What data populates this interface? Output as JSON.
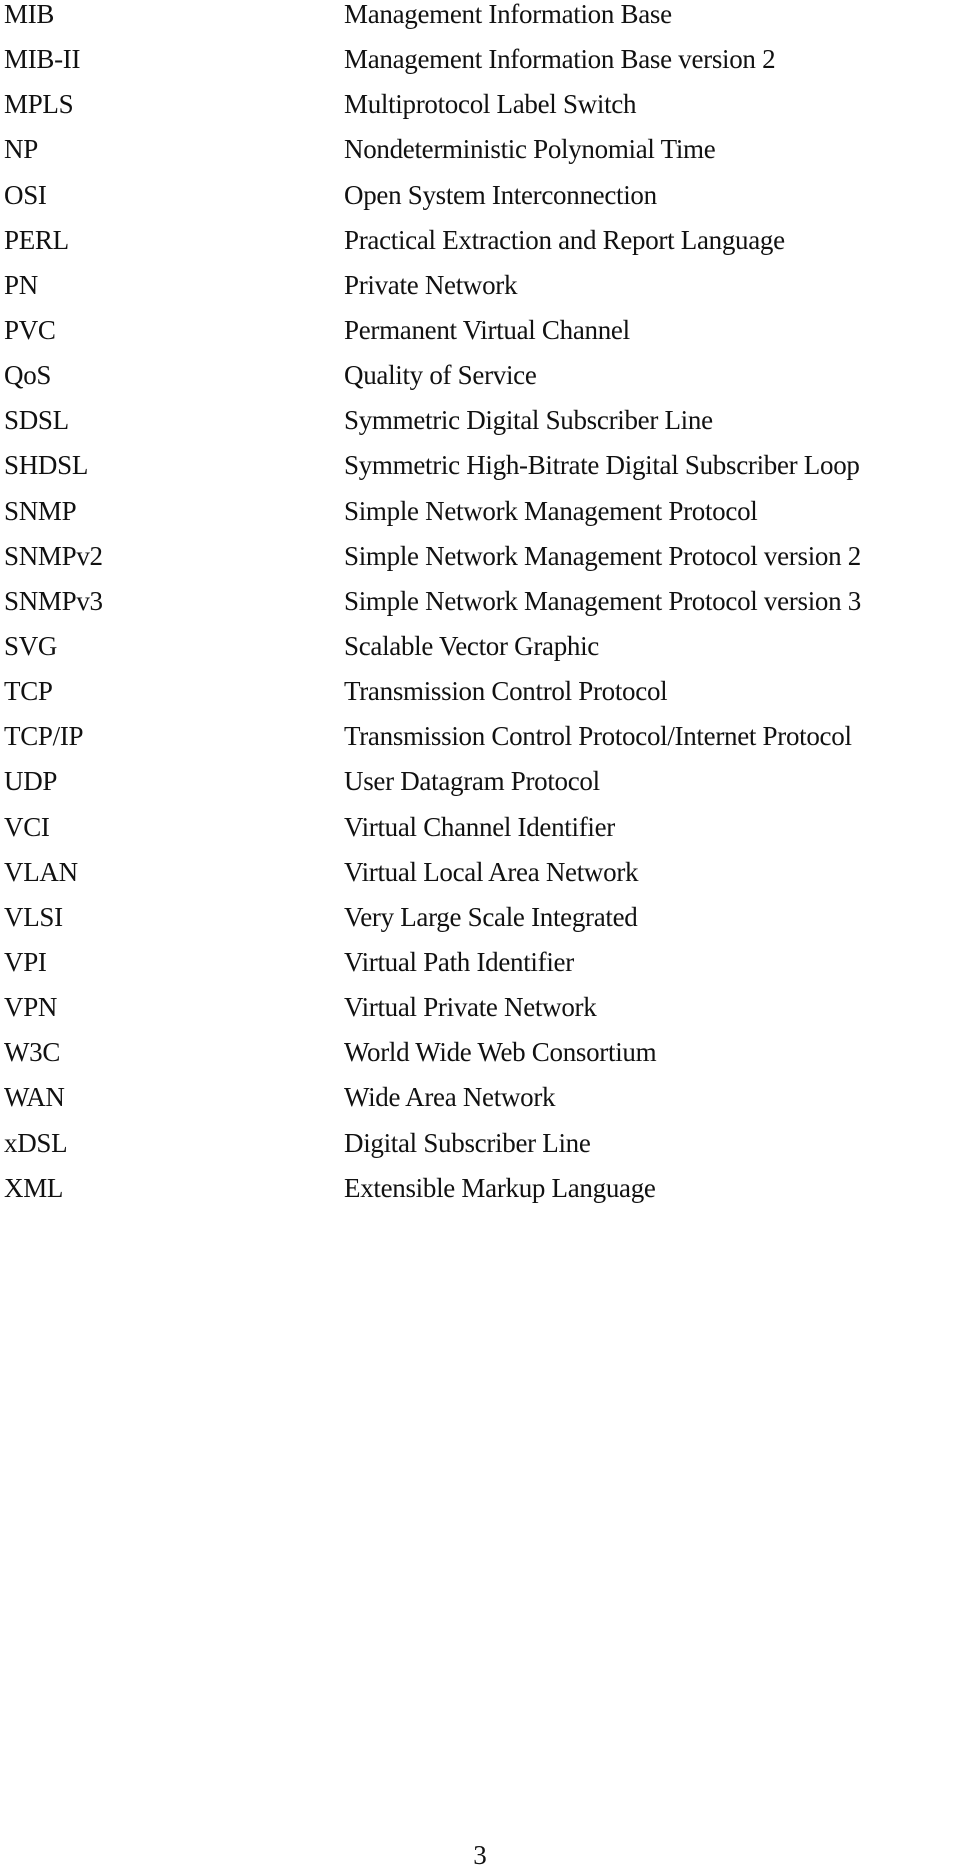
{
  "abbreviations": [
    {
      "term": "MIB",
      "definition": "Management Information Base"
    },
    {
      "term": "MIB-II",
      "definition": "Management Information Base version 2"
    },
    {
      "term": "MPLS",
      "definition": "Multiprotocol Label Switch"
    },
    {
      "term": "NP",
      "definition": "Nondeterministic Polynomial Time"
    },
    {
      "term": "OSI",
      "definition": "Open System Interconnection"
    },
    {
      "term": "PERL",
      "definition": "Practical Extraction and Report Language"
    },
    {
      "term": "PN",
      "definition": "Private Network"
    },
    {
      "term": "PVC",
      "definition": "Permanent Virtual Channel"
    },
    {
      "term": "QoS",
      "definition": "Quality of Service"
    },
    {
      "term": "SDSL",
      "definition": "Symmetric Digital Subscriber Line"
    },
    {
      "term": "SHDSL",
      "definition": "Symmetric High-Bitrate Digital Subscriber Loop"
    },
    {
      "term": "SNMP",
      "definition": "Simple Network Management Protocol"
    },
    {
      "term": "SNMPv2",
      "definition": "Simple Network Management Protocol version 2"
    },
    {
      "term": "SNMPv3",
      "definition": "Simple Network Management Protocol version 3"
    },
    {
      "term": "SVG",
      "definition": "Scalable Vector Graphic"
    },
    {
      "term": "TCP",
      "definition": "Transmission Control Protocol"
    },
    {
      "term": "TCP/IP",
      "definition": "Transmission Control Protocol/Internet Protocol"
    },
    {
      "term": "UDP",
      "definition": "User Datagram Protocol"
    },
    {
      "term": "VCI",
      "definition": "Virtual Channel Identifier"
    },
    {
      "term": "VLAN",
      "definition": "Virtual Local Area Network"
    },
    {
      "term": "VLSI",
      "definition": "Very Large Scale Integrated"
    },
    {
      "term": "VPI",
      "definition": "Virtual Path Identifier"
    },
    {
      "term": "VPN",
      "definition": "Virtual Private Network"
    },
    {
      "term": "W3C",
      "definition": "World Wide Web Consortium"
    },
    {
      "term": "WAN",
      "definition": "Wide Area Network"
    },
    {
      "term": "xDSL",
      "definition": "Digital Subscriber Line"
    },
    {
      "term": "XML",
      "definition": "Extensible Markup Language"
    }
  ],
  "page": {
    "number": "3"
  }
}
